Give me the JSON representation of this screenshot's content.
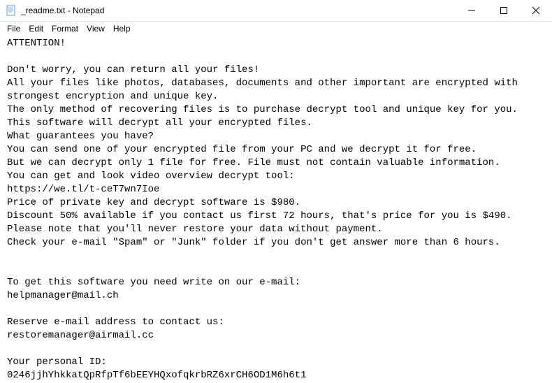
{
  "titlebar": {
    "title": "_readme.txt - Notepad"
  },
  "menubar": {
    "file": "File",
    "edit": "Edit",
    "format": "Format",
    "view": "View",
    "help": "Help"
  },
  "content": {
    "text": "ATTENTION!\n\nDon't worry, you can return all your files!\nAll your files like photos, databases, documents and other important are encrypted with strongest encryption and unique key.\nThe only method of recovering files is to purchase decrypt tool and unique key for you.\nThis software will decrypt all your encrypted files.\nWhat guarantees you have?\nYou can send one of your encrypted file from your PC and we decrypt it for free.\nBut we can decrypt only 1 file for free. File must not contain valuable information.\nYou can get and look video overview decrypt tool:\nhttps://we.tl/t-ceT7wn7Ioe\nPrice of private key and decrypt software is $980.\nDiscount 50% available if you contact us first 72 hours, that's price for you is $490.\nPlease note that you'll never restore your data without payment.\nCheck your e-mail \"Spam\" or \"Junk\" folder if you don't get answer more than 6 hours.\n\n\nTo get this software you need write on our e-mail:\nhelpmanager@mail.ch\n\nReserve e-mail address to contact us:\nrestoremanager@airmail.cc\n\nYour personal ID:\n0246jjhYhkkatQpRfpTf6bEEYHQxofqkrbRZ6xrCH6OD1M6h6t1"
  }
}
